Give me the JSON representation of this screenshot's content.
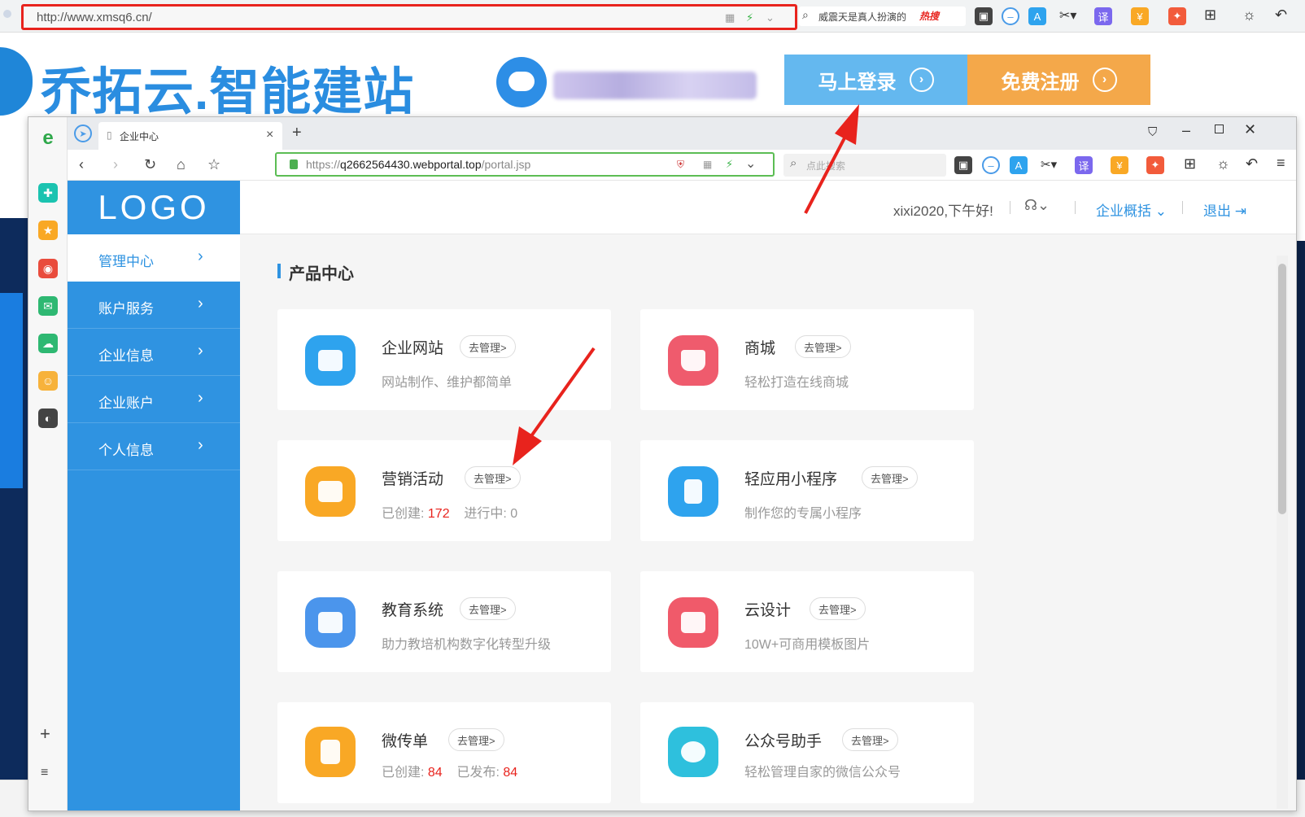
{
  "outer_browser": {
    "url": "http://www.xmsq6.cn/",
    "search_text": "威震天是真人扮演的",
    "search_hot": "热搜"
  },
  "site": {
    "logo_text": "乔拓云.智能建站",
    "login_button": "马上登录",
    "register_button": "免费注册"
  },
  "inner_browser": {
    "tab_title": "企业中心",
    "url_prefix": "https://",
    "url_host": "q2662564430.webportal.top",
    "url_path": "/portal.jsp",
    "search_placeholder": "点此搜索"
  },
  "portal": {
    "logo": "LOGO",
    "greeting": "xixi2020,下午好!",
    "overview_link": "企业概括",
    "logout_link": "退出",
    "menu": [
      {
        "label": "管理中心",
        "active": true
      },
      {
        "label": "账户服务",
        "active": false
      },
      {
        "label": "企业信息",
        "active": false
      },
      {
        "label": "企业账户",
        "active": false
      },
      {
        "label": "个人信息",
        "active": false
      }
    ],
    "section_title": "产品中心",
    "manage_label": "去管理>",
    "cards": [
      {
        "name": "企业网站",
        "desc": "网站制作、维护都简单",
        "color": "#2ea3ee",
        "icon": "website-icon"
      },
      {
        "name": "商城",
        "desc": "轻松打造在线商城",
        "color": "#ef5b6d",
        "icon": "shopping-bag-icon"
      },
      {
        "name": "营销活动",
        "desc_parts": [
          "已创建:",
          "172",
          "进行中:",
          "0"
        ],
        "color": "#f9a825",
        "icon": "gift-icon"
      },
      {
        "name": "轻应用小程序",
        "desc": "制作您的专属小程序",
        "color": "#2ea3ee",
        "icon": "mini-program-icon"
      },
      {
        "name": "教育系统",
        "desc": "助力教培机构数字化转型升级",
        "color": "#4b95ec",
        "icon": "book-icon"
      },
      {
        "name": "云设计",
        "desc": "10W+可商用模板图片",
        "color": "#f05a6a",
        "icon": "image-icon"
      },
      {
        "name": "微传单",
        "desc_parts": [
          "已创建:",
          "84",
          "已发布:",
          "84"
        ],
        "color": "#f9a825",
        "icon": "flyer-icon"
      },
      {
        "name": "公众号助手",
        "desc": "轻松管理自家的微信公众号",
        "color": "#2ec0dd",
        "icon": "wechat-icon"
      }
    ]
  },
  "colors": {
    "accent": "#2f93e1",
    "highlight": "#e8231d",
    "login": "#64b8ef",
    "register": "#f4a84a"
  }
}
